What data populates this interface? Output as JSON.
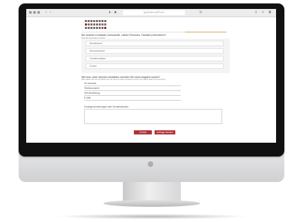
{
  "browser": {
    "url": "gutachten.de/Form"
  },
  "logo": {
    "rows": [
      "dots-1",
      "dots-2",
      "dots-3"
    ]
  },
  "question1": {
    "title": "Bei welchen Kontakten (Verwandte, Lieben Personen, Familien) informieren?",
    "subtitle": "Mehrfachauswahl möglich",
    "options": [
      "Bundesland",
      "Berufsbranche",
      "Familienaufbau",
      "E-Mail"
    ]
  },
  "question2": {
    "title": "Wie bzw. unter welchen Kontakten möchten Sie unser Angebot nutzen?",
    "subtitle": "Bitte wählen Sie ein Kontaktart aus, die Sie am besten erreichen können und welche Daten Sie wünschen.",
    "fields": [
      "Ihr Vorname",
      "Telefonnummer",
      "Ihre Anmerkung",
      "E-Mail"
    ]
  },
  "comment": {
    "label": "Sonstige Anmerkungen oder Sonderwünsche"
  },
  "buttons": {
    "back": "Zurück",
    "submit": "Anfrage senden"
  },
  "colors": {
    "accent": "#b23036",
    "orange": "#d9a05b"
  }
}
